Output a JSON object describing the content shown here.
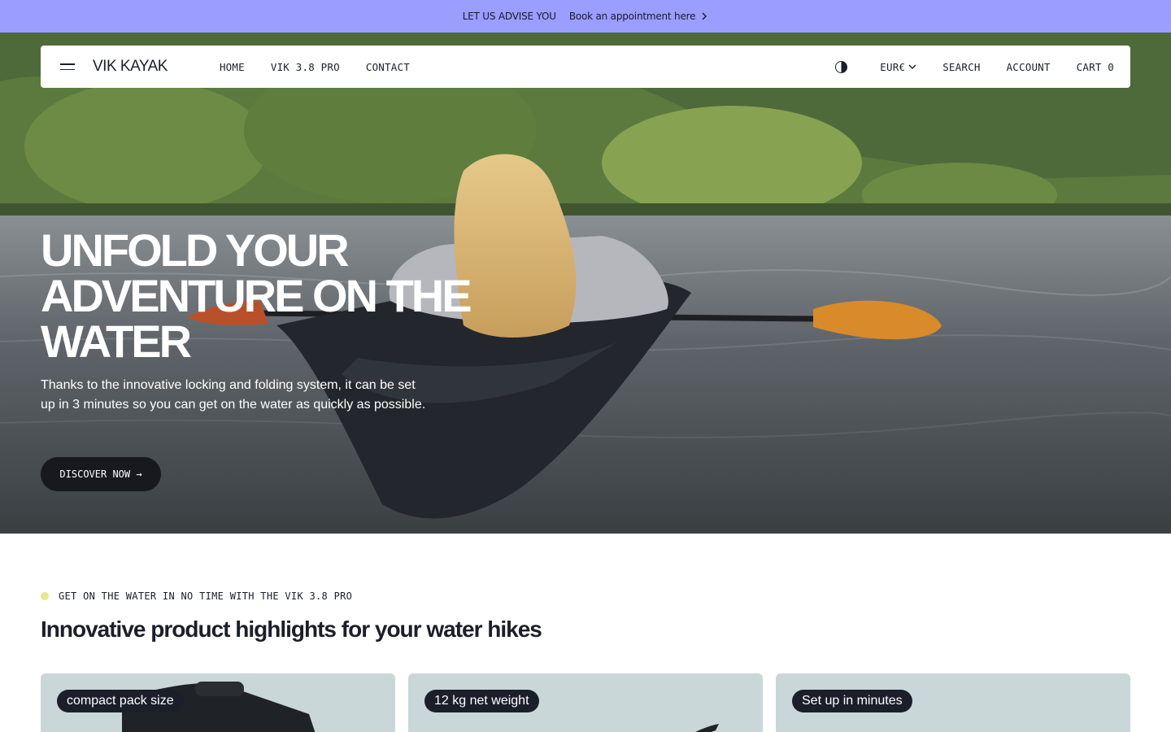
{
  "announcement": {
    "text": "LET US ADVISE YOU",
    "link_label": "Book an appointment here",
    "link_icon": "chevron-right-icon"
  },
  "header": {
    "logo": "VIK KAYAK",
    "nav": [
      "HOME",
      "VIK 3.8 PRO",
      "CONTACT"
    ],
    "theme_icon": "contrast-icon",
    "currency": "EUR€",
    "search": "SEARCH",
    "account": "ACCOUNT",
    "cart": "CART 0"
  },
  "hero": {
    "title": "UNFOLD YOUR ADVENTURE ON THE WATER",
    "subtitle": "Thanks to the innovative locking and folding system, it can be set up in 3 minutes so you can get on the water as quickly as possible.",
    "cta": "DISCOVER NOW →"
  },
  "highlights": {
    "eyebrow": "GET ON THE WATER IN NO TIME WITH THE VIK 3.8 PRO",
    "title": "Innovative product highlights for your water hikes",
    "cards": [
      {
        "tag": "compact pack size"
      },
      {
        "tag": "12 kg net weight"
      },
      {
        "tag": "Set up in minutes"
      }
    ]
  },
  "colors": {
    "announcement_bg": "#9b9dff",
    "button_dark": "#17191e",
    "accent_dot": "#e3ea8c",
    "card_bg": "#c9d7d9"
  }
}
